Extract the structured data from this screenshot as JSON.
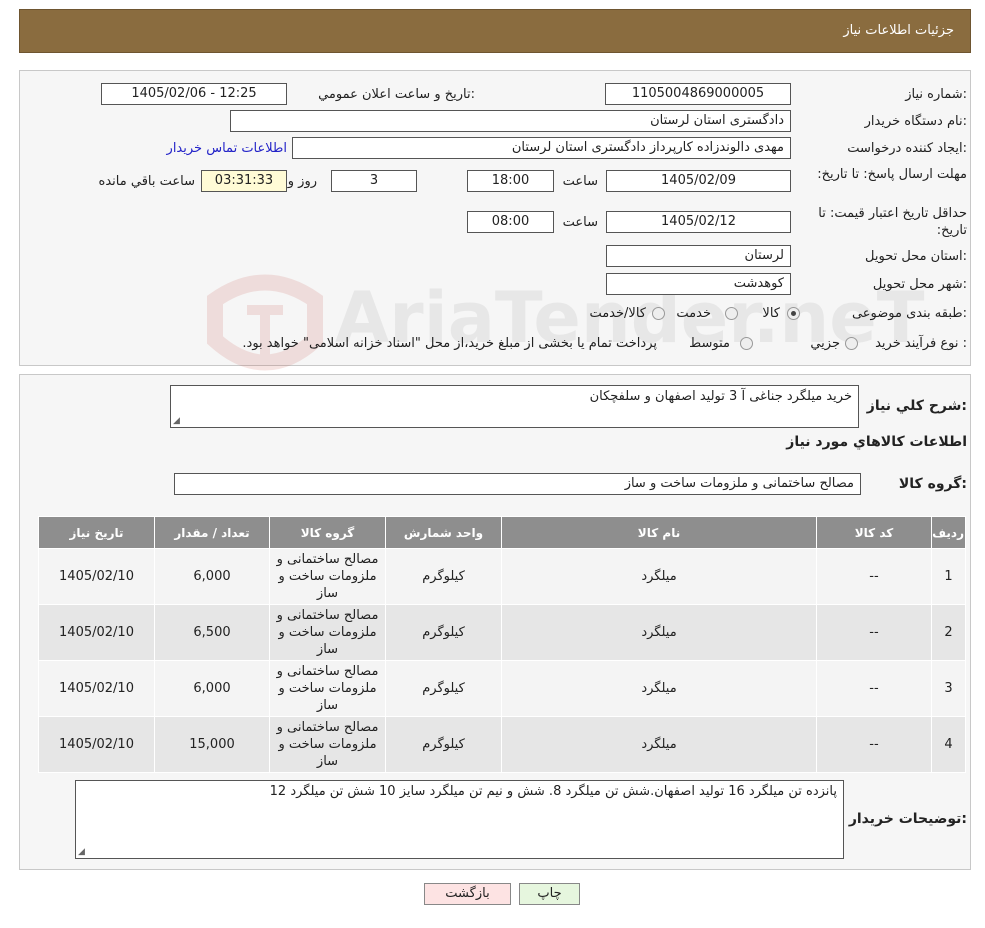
{
  "header": {
    "title": "جزئیات اطلاعات نیاز"
  },
  "form": {
    "need_number_label": "شماره نیاز:",
    "need_number": "1105004869000005",
    "announce_label": "تاریخ و ساعت اعلان عمومي:",
    "announce_value": "1405/02/06 - 12:25",
    "buyer_org_label": "نام دستگاه خریدار:",
    "buyer_org": "دادگستری استان لرستان",
    "creator_label": "ایجاد کننده درخواست:",
    "creator": "مهدی دالوندزاده کارپرداز دادگستری استان لرستان",
    "contact_link": "اطلاعات تماس خریدار",
    "deadline_label": "مهلت ارسال پاسخ: تا تاریخ:",
    "deadline_date": "1405/02/09",
    "time_label": "ساعت",
    "deadline_time": "18:00",
    "days_value": "3",
    "days_label": "روز و",
    "remaining_time": "03:31:33",
    "remaining_label": "ساعت باقي مانده",
    "validity_label": "حداقل تاریخ اعتبار قیمت: تا تاریخ:",
    "validity_date": "1405/02/12",
    "validity_time": "08:00",
    "province_label": "استان محل تحویل:",
    "province": "لرستان",
    "city_label": "شهر محل تحویل:",
    "city": "کوهدشت",
    "category_label": "طبقه بندی موضوعی:",
    "category_options": [
      "کالا",
      "خدمت",
      "کالا/خدمت"
    ],
    "category_selected": "کالا",
    "process_label": "نوع فرآیند خرید :",
    "process_options": [
      "جزیي",
      "متوسط"
    ],
    "process_note": "پرداخت تمام یا بخشی از مبلغ خرید،از محل \"اسناد خزانه اسلامی\" خواهد بود."
  },
  "details": {
    "summary_label": "شرح کلي نیاز:",
    "summary": "خرید میلگرد جناغی آ 3 تولید اصفهان و سلفچکان",
    "items_title": "اطلاعات کالاهاي مورد نیاز",
    "group_label": "گروه کالا:",
    "group_value": "مصالح ساختمانی و ملزومات ساخت و ساز",
    "table": {
      "headers": [
        "ردیف",
        "کد کالا",
        "نام کالا",
        "واحد شمارش",
        "گروه کالا",
        "تعداد / مقدار",
        "تاریخ نیاز"
      ],
      "rows": [
        [
          "1",
          "--",
          "میلگرد",
          "کیلوگرم",
          "مصالح ساختمانی و ملزومات ساخت و ساز",
          "6,000",
          "1405/02/10"
        ],
        [
          "2",
          "--",
          "میلگرد",
          "کیلوگرم",
          "مصالح ساختمانی و ملزومات ساخت و ساز",
          "6,500",
          "1405/02/10"
        ],
        [
          "3",
          "--",
          "میلگرد",
          "کیلوگرم",
          "مصالح ساختمانی و ملزومات ساخت و ساز",
          "6,000",
          "1405/02/10"
        ],
        [
          "4",
          "--",
          "میلگرد",
          "کیلوگرم",
          "مصالح ساختمانی و ملزومات ساخت و ساز",
          "15,000",
          "1405/02/10"
        ]
      ]
    },
    "buyer_notes_label": "توضیحات خریدار:",
    "buyer_notes": "پانزده تن میلگرد 16 تولید اصفهان.شش تن میلگرد 8. شش و نیم تن میلگرد سایز 10 شش تن میلگرد 12"
  },
  "buttons": {
    "print": "چاپ",
    "back": "بازگشت"
  },
  "watermark": {
    "text": "AriaTender.neT"
  },
  "colors": {
    "header_bg": "#8a6c3f",
    "table_header_bg": "#8e8e8e",
    "link": "#2323c8",
    "timer_bg": "#fffbd6",
    "back_button_bg": "#fde3e3",
    "print_button_bg": "#e6f6de"
  }
}
